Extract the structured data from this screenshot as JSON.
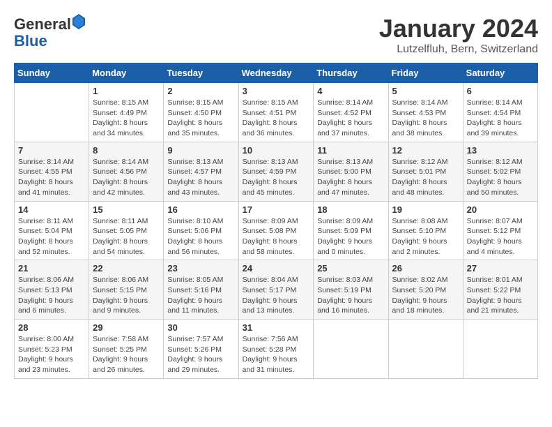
{
  "header": {
    "logo_general": "General",
    "logo_blue": "Blue",
    "title": "January 2024",
    "subtitle": "Lutzelfluh, Bern, Switzerland"
  },
  "calendar": {
    "days_of_week": [
      "Sunday",
      "Monday",
      "Tuesday",
      "Wednesday",
      "Thursday",
      "Friday",
      "Saturday"
    ],
    "weeks": [
      [
        {
          "day": "",
          "info": ""
        },
        {
          "day": "1",
          "info": "Sunrise: 8:15 AM\nSunset: 4:49 PM\nDaylight: 8 hours\nand 34 minutes."
        },
        {
          "day": "2",
          "info": "Sunrise: 8:15 AM\nSunset: 4:50 PM\nDaylight: 8 hours\nand 35 minutes."
        },
        {
          "day": "3",
          "info": "Sunrise: 8:15 AM\nSunset: 4:51 PM\nDaylight: 8 hours\nand 36 minutes."
        },
        {
          "day": "4",
          "info": "Sunrise: 8:14 AM\nSunset: 4:52 PM\nDaylight: 8 hours\nand 37 minutes."
        },
        {
          "day": "5",
          "info": "Sunrise: 8:14 AM\nSunset: 4:53 PM\nDaylight: 8 hours\nand 38 minutes."
        },
        {
          "day": "6",
          "info": "Sunrise: 8:14 AM\nSunset: 4:54 PM\nDaylight: 8 hours\nand 39 minutes."
        }
      ],
      [
        {
          "day": "7",
          "info": "Sunrise: 8:14 AM\nSunset: 4:55 PM\nDaylight: 8 hours\nand 41 minutes."
        },
        {
          "day": "8",
          "info": "Sunrise: 8:14 AM\nSunset: 4:56 PM\nDaylight: 8 hours\nand 42 minutes."
        },
        {
          "day": "9",
          "info": "Sunrise: 8:13 AM\nSunset: 4:57 PM\nDaylight: 8 hours\nand 43 minutes."
        },
        {
          "day": "10",
          "info": "Sunrise: 8:13 AM\nSunset: 4:59 PM\nDaylight: 8 hours\nand 45 minutes."
        },
        {
          "day": "11",
          "info": "Sunrise: 8:13 AM\nSunset: 5:00 PM\nDaylight: 8 hours\nand 47 minutes."
        },
        {
          "day": "12",
          "info": "Sunrise: 8:12 AM\nSunset: 5:01 PM\nDaylight: 8 hours\nand 48 minutes."
        },
        {
          "day": "13",
          "info": "Sunrise: 8:12 AM\nSunset: 5:02 PM\nDaylight: 8 hours\nand 50 minutes."
        }
      ],
      [
        {
          "day": "14",
          "info": "Sunrise: 8:11 AM\nSunset: 5:04 PM\nDaylight: 8 hours\nand 52 minutes."
        },
        {
          "day": "15",
          "info": "Sunrise: 8:11 AM\nSunset: 5:05 PM\nDaylight: 8 hours\nand 54 minutes."
        },
        {
          "day": "16",
          "info": "Sunrise: 8:10 AM\nSunset: 5:06 PM\nDaylight: 8 hours\nand 56 minutes."
        },
        {
          "day": "17",
          "info": "Sunrise: 8:09 AM\nSunset: 5:08 PM\nDaylight: 8 hours\nand 58 minutes."
        },
        {
          "day": "18",
          "info": "Sunrise: 8:09 AM\nSunset: 5:09 PM\nDaylight: 9 hours\nand 0 minutes."
        },
        {
          "day": "19",
          "info": "Sunrise: 8:08 AM\nSunset: 5:10 PM\nDaylight: 9 hours\nand 2 minutes."
        },
        {
          "day": "20",
          "info": "Sunrise: 8:07 AM\nSunset: 5:12 PM\nDaylight: 9 hours\nand 4 minutes."
        }
      ],
      [
        {
          "day": "21",
          "info": "Sunrise: 8:06 AM\nSunset: 5:13 PM\nDaylight: 9 hours\nand 6 minutes."
        },
        {
          "day": "22",
          "info": "Sunrise: 8:06 AM\nSunset: 5:15 PM\nDaylight: 9 hours\nand 9 minutes."
        },
        {
          "day": "23",
          "info": "Sunrise: 8:05 AM\nSunset: 5:16 PM\nDaylight: 9 hours\nand 11 minutes."
        },
        {
          "day": "24",
          "info": "Sunrise: 8:04 AM\nSunset: 5:17 PM\nDaylight: 9 hours\nand 13 minutes."
        },
        {
          "day": "25",
          "info": "Sunrise: 8:03 AM\nSunset: 5:19 PM\nDaylight: 9 hours\nand 16 minutes."
        },
        {
          "day": "26",
          "info": "Sunrise: 8:02 AM\nSunset: 5:20 PM\nDaylight: 9 hours\nand 18 minutes."
        },
        {
          "day": "27",
          "info": "Sunrise: 8:01 AM\nSunset: 5:22 PM\nDaylight: 9 hours\nand 21 minutes."
        }
      ],
      [
        {
          "day": "28",
          "info": "Sunrise: 8:00 AM\nSunset: 5:23 PM\nDaylight: 9 hours\nand 23 minutes."
        },
        {
          "day": "29",
          "info": "Sunrise: 7:58 AM\nSunset: 5:25 PM\nDaylight: 9 hours\nand 26 minutes."
        },
        {
          "day": "30",
          "info": "Sunrise: 7:57 AM\nSunset: 5:26 PM\nDaylight: 9 hours\nand 29 minutes."
        },
        {
          "day": "31",
          "info": "Sunrise: 7:56 AM\nSunset: 5:28 PM\nDaylight: 9 hours\nand 31 minutes."
        },
        {
          "day": "",
          "info": ""
        },
        {
          "day": "",
          "info": ""
        },
        {
          "day": "",
          "info": ""
        }
      ]
    ]
  }
}
